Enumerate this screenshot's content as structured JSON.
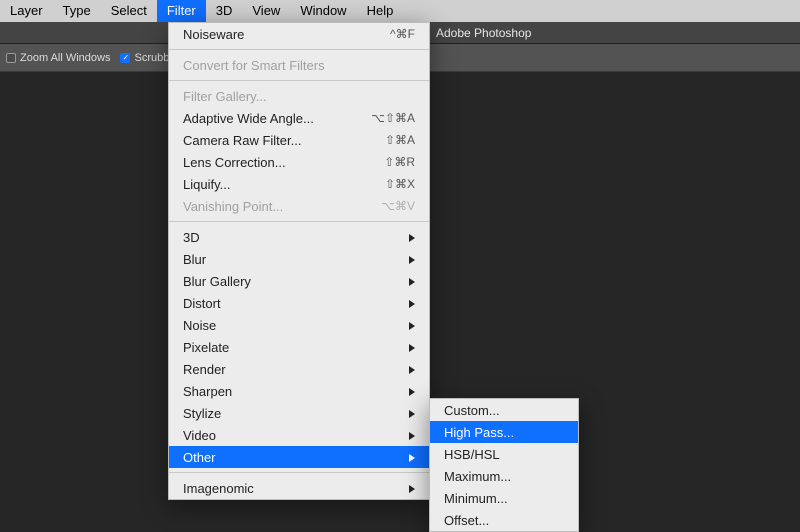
{
  "menubar": {
    "items": [
      {
        "label": "Layer"
      },
      {
        "label": "Type"
      },
      {
        "label": "Select"
      },
      {
        "label": "Filter"
      },
      {
        "label": "3D"
      },
      {
        "label": "View"
      },
      {
        "label": "Window"
      },
      {
        "label": "Help"
      }
    ],
    "selected_index": 3
  },
  "app": {
    "title": "Adobe Photoshop"
  },
  "options_bar": {
    "zoom_all_windows": {
      "label": "Zoom All Windows",
      "checked": false
    },
    "scrubby_zoom": {
      "label": "Scrubb",
      "checked": true
    }
  },
  "filter_menu": {
    "sections": [
      [
        {
          "label": "Noiseware",
          "shortcut": "^⌘F",
          "disabled": false
        }
      ],
      [
        {
          "label": "Convert for Smart Filters",
          "disabled": true
        }
      ],
      [
        {
          "label": "Filter Gallery...",
          "disabled": true
        },
        {
          "label": "Adaptive Wide Angle...",
          "shortcut": "⌥⇧⌘A",
          "disabled": false
        },
        {
          "label": "Camera Raw Filter...",
          "shortcut": "⇧⌘A",
          "disabled": false
        },
        {
          "label": "Lens Correction...",
          "shortcut": "⇧⌘R",
          "disabled": false
        },
        {
          "label": "Liquify...",
          "shortcut": "⇧⌘X",
          "disabled": false
        },
        {
          "label": "Vanishing Point...",
          "shortcut": "⌥⌘V",
          "disabled": true
        }
      ],
      [
        {
          "label": "3D",
          "submenu": true
        },
        {
          "label": "Blur",
          "submenu": true
        },
        {
          "label": "Blur Gallery",
          "submenu": true
        },
        {
          "label": "Distort",
          "submenu": true
        },
        {
          "label": "Noise",
          "submenu": true
        },
        {
          "label": "Pixelate",
          "submenu": true
        },
        {
          "label": "Render",
          "submenu": true
        },
        {
          "label": "Sharpen",
          "submenu": true
        },
        {
          "label": "Stylize",
          "submenu": true
        },
        {
          "label": "Video",
          "submenu": true
        },
        {
          "label": "Other",
          "submenu": true,
          "selected": true
        }
      ],
      [
        {
          "label": "Imagenomic",
          "submenu": true
        }
      ]
    ]
  },
  "other_submenu": {
    "items": [
      {
        "label": "Custom..."
      },
      {
        "label": "High Pass...",
        "selected": true
      },
      {
        "label": "HSB/HSL"
      },
      {
        "label": "Maximum..."
      },
      {
        "label": "Minimum..."
      },
      {
        "label": "Offset..."
      }
    ]
  }
}
